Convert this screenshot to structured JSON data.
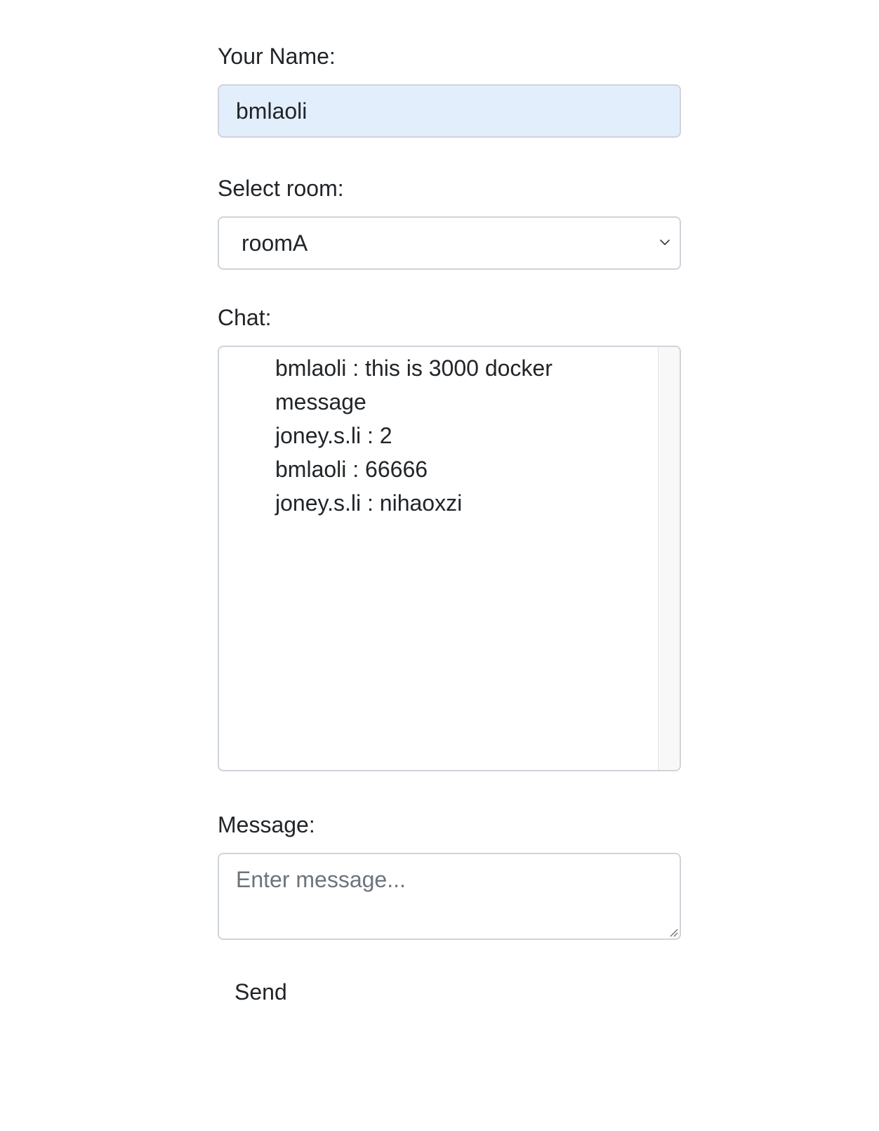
{
  "name_field": {
    "label": "Your Name:",
    "value": "bmlaoli"
  },
  "room_field": {
    "label": "Select room:",
    "selected": "roomA",
    "icon": "chevron-down-icon"
  },
  "chat": {
    "label": "Chat:",
    "messages": [
      "bmlaoli : this is 3000 docker message",
      "joney.s.li : 2",
      "bmlaoli : 66666",
      "joney.s.li : nihaoxzi"
    ]
  },
  "message_field": {
    "label": "Message:",
    "placeholder": "Enter message..."
  },
  "send_button": {
    "label": "Send"
  },
  "colors": {
    "autofill_bg": "#e3eefd",
    "border": "#ced4da",
    "text": "#212529",
    "placeholder": "#6c757d"
  }
}
